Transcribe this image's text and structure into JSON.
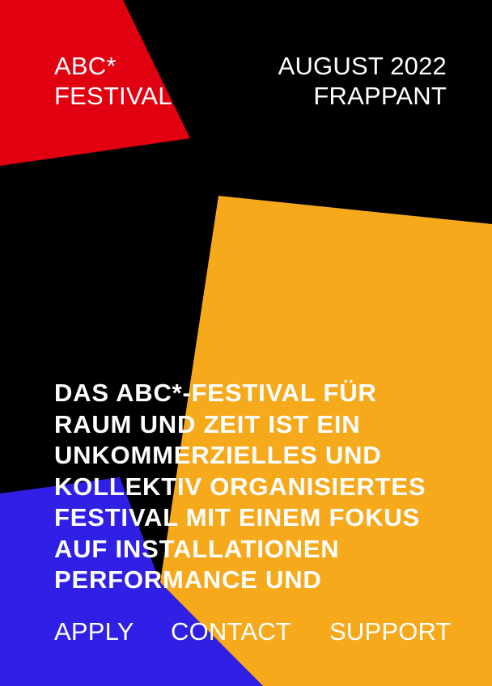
{
  "colors": {
    "background": "#000000",
    "red": "#e1000f",
    "yellow": "#f7a91c",
    "blue": "#3020e6",
    "text": "#ffffff"
  },
  "header": {
    "brand_line1": "ABC*",
    "brand_line2": "FESTIVAL",
    "date": "AUGUST 2022",
    "venue": "FRAPPANT"
  },
  "intro": {
    "lines": [
      "DAS ABC*-FESTIVAL FÜR",
      "RAUM UND ZEIT IST EIN",
      "UNKOMMERZIELLES UND",
      "KOLLEKTIV ORGANISIERTES",
      "FESTIVAL MIT EINEM FOKUS",
      "AUF INSTALLATIONEN",
      "PERFORMANCE UND"
    ]
  },
  "nav": {
    "apply": "APPLY",
    "contact": "CONTACT",
    "support": "SUPPORT"
  }
}
